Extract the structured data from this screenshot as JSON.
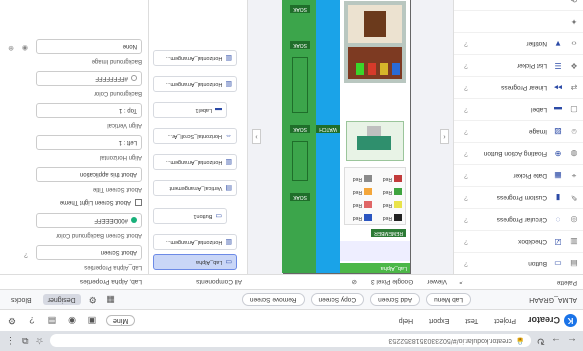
{
  "browser": {
    "url": "creator.kodular.io/#/5023303518352253",
    "window_title": "Kodular Creator"
  },
  "app_header": {
    "brand": "Creator",
    "menu": [
      "Project",
      "Test",
      "Export",
      "Help"
    ],
    "profile_label": "Mine"
  },
  "toolbar": {
    "project_name": "ALMA_GRAAH",
    "buttons": [
      "Lab Menu",
      "Add Screen",
      "Copy Screen",
      "Remove Screen"
    ],
    "tabs": [
      "Designer",
      "Blocks"
    ],
    "active_tab": "Designer"
  },
  "subheader": {
    "palette": "Palette",
    "viewer": "Viewer",
    "screen_label": "Google Pixel 3",
    "components": "All Components",
    "properties": "Lab, Alpha Properties"
  },
  "palette": {
    "items": [
      {
        "label": "Button",
        "icon": "button-icon"
      },
      {
        "label": "Checkbox",
        "icon": "checkbox-icon"
      },
      {
        "label": "Circular Progress",
        "icon": "circular-progress-icon"
      },
      {
        "label": "Custom Progress",
        "icon": "custom-progress-icon"
      },
      {
        "label": "Date Picker",
        "icon": "date-picker-icon"
      },
      {
        "label": "Floating Action Button",
        "icon": "fab-icon"
      },
      {
        "label": "Image",
        "icon": "image-icon"
      },
      {
        "label": "Label",
        "icon": "label-icon"
      },
      {
        "label": "Linear Progress",
        "icon": "linear-progress-icon"
      },
      {
        "label": "List Picker",
        "icon": "list-picker-icon"
      },
      {
        "label": "Notifier",
        "icon": "notifier-icon"
      }
    ],
    "side_icons": [
      "user-interface-icon",
      "layout-icon",
      "media-icon",
      "drawing-icon",
      "maps-icon",
      "sensors-icon",
      "social-icon",
      "storage-icon",
      "connectivity-icon",
      "lego-icon",
      "code-icon",
      "extension-icon",
      "settings-icon"
    ]
  },
  "viewer": {
    "green_buttons": [
      "SOAK",
      "SOAK",
      "WATCH",
      "SOAK",
      "SOAK"
    ],
    "bottom_label": "Lab_Alpha",
    "bar_label": "REMEMBER",
    "legend": [
      "Red",
      "Red",
      "Red",
      "Red",
      "Red",
      "Red",
      "Red",
      "Red"
    ]
  },
  "tree": {
    "nodes": [
      {
        "label": "Lab_Alpha",
        "selected": true
      },
      {
        "label": "Horizontal_Arrangem...",
        "selected": false
      },
      {
        "label": "Button1",
        "selected": false
      },
      {
        "label": "Vertical_Arrangement",
        "selected": false
      },
      {
        "label": "Horizontal_Arrangem...",
        "selected": false
      },
      {
        "label": "Horizontal_Scroll_Ar...",
        "selected": false
      },
      {
        "label": "Label1",
        "selected": false
      },
      {
        "label": "Horizontal_Arrangem...",
        "selected": false
      },
      {
        "label": "Horizontal_Arrangem...",
        "selected": false
      }
    ]
  },
  "properties": {
    "header": "Lab_Alpha Properties",
    "fields": [
      {
        "title": "About Screen",
        "value": "About Screen"
      },
      {
        "title": "About Screen Background Color",
        "value": "#00DEEEFF"
      },
      {
        "title": "About Screen Title",
        "value": "About this application"
      },
      {
        "title": "Align Horizontal",
        "value": "Left : 1"
      },
      {
        "title": "Align Vertical",
        "value": "Top : 1"
      },
      {
        "title": "Background Color",
        "value": "#FFFFFFFF"
      },
      {
        "title": "Background Image",
        "value": "None"
      }
    ],
    "checkbox_label": "About Screen Light Theme"
  }
}
